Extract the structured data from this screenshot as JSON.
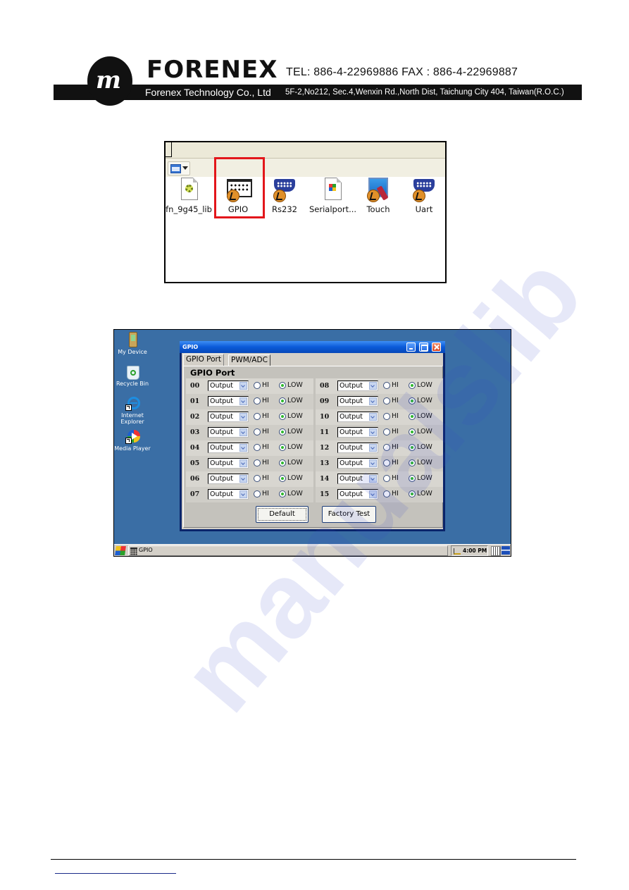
{
  "letterhead": {
    "brand": "FORENEX",
    "logo_glyph": "m",
    "contact": "TEL: 886-4-22969886  FAX : 886-4-22969887",
    "company": "Forenex Technology Co., Ltd",
    "address": "5F-2,No212, Sec.4,Wenxin Rd.,North Dist, Taichung City 404, Taiwan(R.O.C.)"
  },
  "explorer": {
    "items": [
      {
        "label": "fn_9g45_lib",
        "icon": "settings-file-icon"
      },
      {
        "label": "GPIO",
        "icon": "gpio-app-icon",
        "highlighted": true
      },
      {
        "label": "Rs232",
        "icon": "serial-port-app-icon"
      },
      {
        "label": "Serialport...",
        "icon": "windows-document-icon"
      },
      {
        "label": "Touch",
        "icon": "touch-app-icon"
      },
      {
        "label": "Uart",
        "icon": "serial-port-app-icon"
      }
    ],
    "highlight_color": "#e3161b"
  },
  "desktop": {
    "icons": [
      {
        "label": "My Device",
        "icon": "my-device-icon"
      },
      {
        "label": "Recycle Bin",
        "icon": "recycle-bin-icon"
      },
      {
        "label": "Internet Explorer",
        "icon": "internet-explorer-icon"
      },
      {
        "label": "Media Player",
        "icon": "media-player-icon"
      }
    ],
    "background_color": "#3a6ea5"
  },
  "window": {
    "title": "GPIO",
    "tabs": [
      {
        "label": "GPIO Port",
        "active": true
      },
      {
        "label": "PWM/ADC",
        "active": false
      }
    ],
    "panel_title": "GPIO Port",
    "hi_label": "HI",
    "low_label": "LOW",
    "ports": [
      {
        "pin": "00",
        "mode": "Output",
        "state": "LOW"
      },
      {
        "pin": "01",
        "mode": "Output",
        "state": "LOW"
      },
      {
        "pin": "02",
        "mode": "Output",
        "state": "LOW"
      },
      {
        "pin": "03",
        "mode": "Output",
        "state": "LOW"
      },
      {
        "pin": "04",
        "mode": "Output",
        "state": "LOW"
      },
      {
        "pin": "05",
        "mode": "Output",
        "state": "LOW"
      },
      {
        "pin": "06",
        "mode": "Output",
        "state": "LOW"
      },
      {
        "pin": "07",
        "mode": "Output",
        "state": "LOW"
      },
      {
        "pin": "08",
        "mode": "Output",
        "state": "LOW"
      },
      {
        "pin": "09",
        "mode": "Output",
        "state": "LOW"
      },
      {
        "pin": "10",
        "mode": "Output",
        "state": "LOW"
      },
      {
        "pin": "11",
        "mode": "Output",
        "state": "LOW"
      },
      {
        "pin": "12",
        "mode": "Output",
        "state": "LOW"
      },
      {
        "pin": "13",
        "mode": "Output",
        "state": "LOW"
      },
      {
        "pin": "14",
        "mode": "Output",
        "state": "LOW"
      },
      {
        "pin": "15",
        "mode": "Output",
        "state": "LOW"
      }
    ],
    "buttons": {
      "default": "Default",
      "factory_test": "Factory Test"
    }
  },
  "taskbar": {
    "task_label": "GPIO",
    "clock": "4:00 PM"
  },
  "watermark": "manualslib"
}
